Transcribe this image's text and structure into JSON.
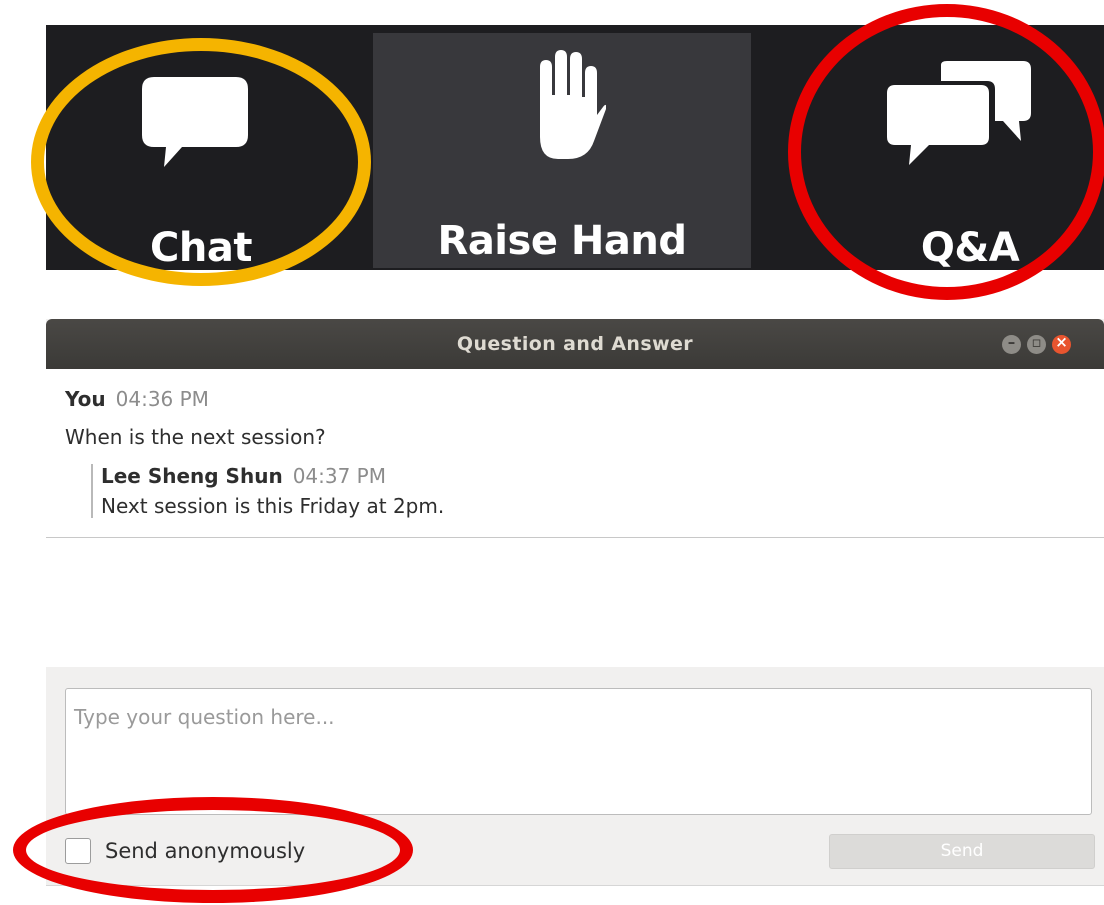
{
  "toolbar": {
    "chat_label": "Chat",
    "raise_hand_label": "Raise Hand",
    "qa_label": "Q&A"
  },
  "dialog": {
    "title": "Question and Answer",
    "messages": [
      {
        "author": "You",
        "time": "04:36 PM",
        "text": "When is the next session?"
      },
      {
        "author": "Lee Sheng Shun",
        "time": "04:37 PM",
        "text": "Next session is this Friday at 2pm."
      }
    ],
    "input": {
      "placeholder": "Type your question here...",
      "value": ""
    },
    "anonymous": {
      "label": "Send anonymously",
      "checked": false
    },
    "send_label": "Send"
  },
  "colors": {
    "highlight_yellow": "#f5b400",
    "highlight_red": "#e80000",
    "toolbar_bg": "#1d1d20",
    "close_button": "#e8552f"
  }
}
